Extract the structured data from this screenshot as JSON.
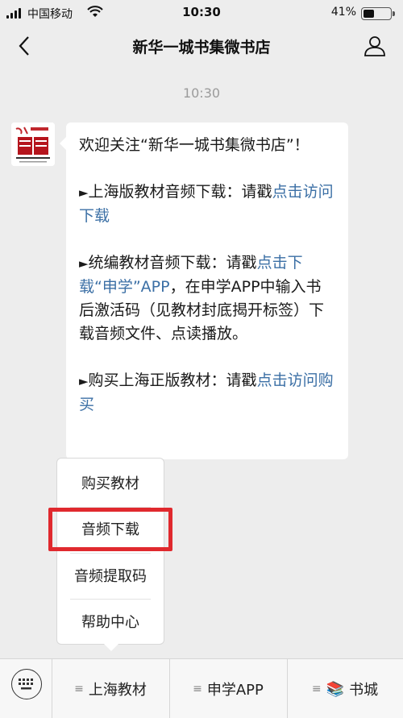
{
  "status_bar": {
    "carrier": "中国移动",
    "time": "10:30",
    "battery": "41%",
    "battery_level": 0.41
  },
  "nav": {
    "title": "新华一城书集微书店"
  },
  "chat": {
    "timestamp": "10:30",
    "message": {
      "p1": "欢迎关注“新华一城书集微书店”！",
      "p2_text": "上海版教材音频下载：请戳",
      "p2_link": "点击访问下载",
      "p3_text_a": "统编教材音频下载：请戳",
      "p3_link": "点击下载“申学”APP",
      "p3_text_b": "，在申学APP中输入书后激活码（见教材封底揭开标签）下载音频文件、点读播放。",
      "p4_text": "购买上海正版教材：请戳",
      "p4_link": "点击访问购买",
      "bullet": "►"
    }
  },
  "popup_menu": {
    "items": [
      "购买教材",
      "音频下载",
      "音频提取码",
      "帮助中心"
    ]
  },
  "bottom_menu": {
    "tabs": [
      "上海教材",
      "申学APP",
      "书城"
    ],
    "menu_glyph": "≡",
    "books_emoji": "📚"
  },
  "colors": {
    "link": "#3b6fa5",
    "highlight": "#e0292e",
    "background": "#ededed"
  }
}
